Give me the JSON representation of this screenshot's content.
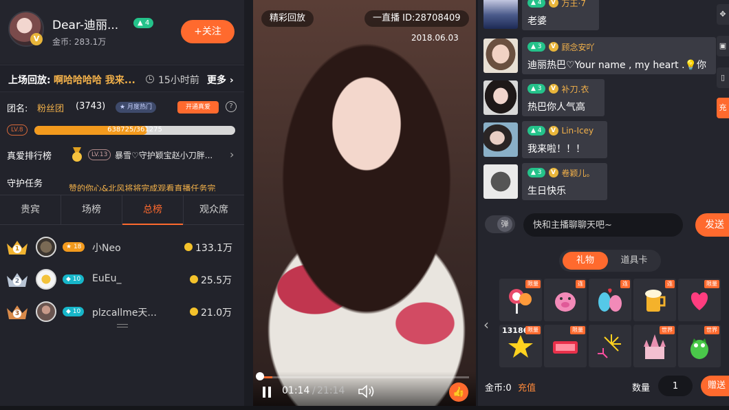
{
  "host": {
    "name": "Dear-迪丽...",
    "level": "4",
    "coins": "金币: 283.1万",
    "follow_label": "+关注",
    "verified_badge": "V"
  },
  "replay": {
    "label": "上场回放:",
    "title": "啊哈哈哈哈 我来...",
    "time": "15小时前",
    "more": "更多"
  },
  "fan_club": {
    "label": "团名:",
    "name": "粉丝团",
    "count": "(3743)",
    "tag": "月度热门",
    "open_label": "开通真爱",
    "help": "?"
  },
  "level_progress": {
    "badge": "LV.8",
    "text": "638725/361275",
    "fill_fraction": 0.56
  },
  "ranking": {
    "label": "真爱排行榜",
    "level": "LV.13",
    "user": "暴雪♡守护颖宝赵小刀胖...",
    "arrow": "›"
  },
  "guard": {
    "label": "守护任务",
    "text": "赞的你心&北风将将完成观看直播任务完"
  },
  "tabs": [
    {
      "label": "贵宾"
    },
    {
      "label": "场榜"
    },
    {
      "label": "总榜"
    },
    {
      "label": "观众席"
    }
  ],
  "leaderboard": [
    {
      "rank": "1",
      "level": "18",
      "name": "小Neo",
      "value": "133.1万"
    },
    {
      "rank": "2",
      "level": "10",
      "name": "EuEu_",
      "value": "25.5万"
    },
    {
      "rank": "3",
      "level": "10",
      "name": "plzcallme天...",
      "value": "21.0万"
    }
  ],
  "video": {
    "replay_tag": "精彩回放",
    "room_id": "一直播 ID:28708409",
    "date": "2018.06.03",
    "time_current": "01:14",
    "time_separator": "/",
    "time_total": "21:14",
    "progress_fraction": 0.06,
    "like_icon": "👍"
  },
  "chat": [
    {
      "level": "4",
      "user": "万王·7",
      "text": "老婆"
    },
    {
      "level": "3",
      "user": "顾念安吖",
      "text": "迪丽热巴♡Your name , my heart .💡你"
    },
    {
      "level": "3",
      "user": "补刀.衣",
      "text": "热巴你人气高"
    },
    {
      "level": "4",
      "user": "Lin-Icey",
      "text": "我来啦！！！"
    },
    {
      "level": "3",
      "user": "卷颖儿。",
      "text": "生日快乐"
    }
  ],
  "input": {
    "danmu_label": "弹",
    "placeholder": "快和主播聊聊天吧~",
    "send_label": "发送"
  },
  "gift_tabs": [
    {
      "label": "礼物"
    },
    {
      "label": "道具卡"
    }
  ],
  "gifts": [
    {
      "name": "lollipop",
      "tag": "限量",
      "count": ""
    },
    {
      "name": "pig",
      "tag": "连",
      "count": ""
    },
    {
      "name": "couple",
      "tag": "连",
      "count": ""
    },
    {
      "name": "beer",
      "tag": "连",
      "count": ""
    },
    {
      "name": "heart",
      "tag": "限量",
      "count": ""
    },
    {
      "name": "star",
      "tag": "限量",
      "count": "13186"
    },
    {
      "name": "love-sign",
      "tag": "限量",
      "count": ""
    },
    {
      "name": "fireworks",
      "tag": "",
      "count": ""
    },
    {
      "name": "castle",
      "tag": "世界",
      "count": ""
    },
    {
      "name": "dragon",
      "tag": "世界",
      "count": ""
    }
  ],
  "footer": {
    "coin_label": "金币:0",
    "recharge_label": "充值",
    "qty_label": "数量",
    "qty_value": "1",
    "give_label": "赠送"
  },
  "side": {
    "charge_label": "充"
  },
  "colors": {
    "accent": "#ff6a2e",
    "gold": "#f4b24a",
    "level_green": "#24c28a"
  }
}
